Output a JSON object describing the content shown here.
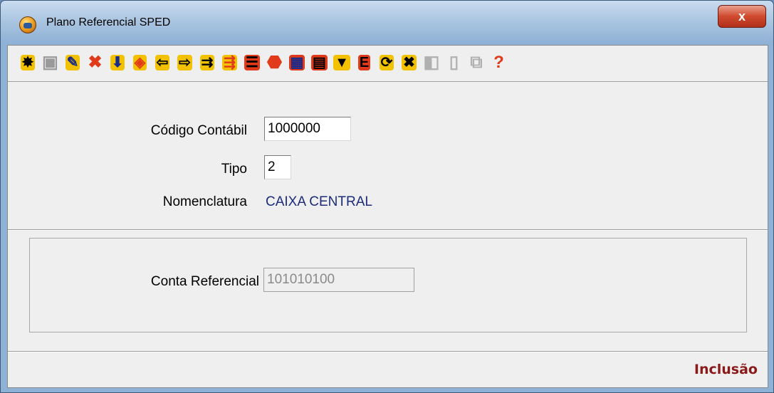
{
  "window": {
    "title": "Plano Referencial SPED",
    "close_label": "x"
  },
  "toolbar": {
    "buttons": [
      {
        "name": "gear-icon",
        "glyph": "✸",
        "color": "#000000",
        "bg": "#f2c200"
      },
      {
        "name": "save-icon",
        "glyph": "▣",
        "color": "#9a9a9a",
        "bg": ""
      },
      {
        "name": "edit-pencil-icon",
        "glyph": "✎",
        "color": "#1a2a8a",
        "bg": "#f2c200"
      },
      {
        "name": "delete-x-icon",
        "glyph": "✖",
        "color": "#e03a1a",
        "bg": ""
      },
      {
        "name": "download-arrow-icon",
        "glyph": "⬇",
        "color": "#1a2a8a",
        "bg": "#f2c200"
      },
      {
        "name": "search-icon",
        "glyph": "◈",
        "color": "#e03a1a",
        "bg": "#f2c200"
      },
      {
        "name": "arrow-left-icon",
        "glyph": "⇦",
        "color": "#000000",
        "bg": "#f2c200"
      },
      {
        "name": "arrow-right-icon",
        "glyph": "⇨",
        "color": "#000000",
        "bg": "#f2c200"
      },
      {
        "name": "export-xy-icon",
        "glyph": "⇉",
        "color": "#000000",
        "bg": "#f2c200"
      },
      {
        "name": "import-xy-icon",
        "glyph": "⇶",
        "color": "#e03a1a",
        "bg": "#f2c200"
      },
      {
        "name": "equal-bars-icon",
        "glyph": "☰",
        "color": "#000000",
        "bg": "#e03a1a"
      },
      {
        "name": "stop-icon",
        "glyph": "⬣",
        "color": "#e03a1a",
        "bg": ""
      },
      {
        "name": "calculator-icon",
        "glyph": "▦",
        "color": "#1a2a8a",
        "bg": "#e03a1a"
      },
      {
        "name": "report-icon",
        "glyph": "▤",
        "color": "#000000",
        "bg": "#e03a1a"
      },
      {
        "name": "comment-icon",
        "glyph": "▼",
        "color": "#000000",
        "bg": "#f2c200"
      },
      {
        "name": "list-e-icon",
        "glyph": "E",
        "color": "#000000",
        "bg": "#e03a1a"
      },
      {
        "name": "refresh-icon",
        "glyph": "⟳",
        "color": "#000000",
        "bg": "#f2c200"
      },
      {
        "name": "folder-icon",
        "glyph": "✖",
        "color": "#000000",
        "bg": "#f2c200"
      },
      {
        "name": "document-grey-icon",
        "glyph": "◧",
        "color": "#b0b0b0",
        "bg": ""
      },
      {
        "name": "page-grey-icon",
        "glyph": "▯",
        "color": "#b0b0b0",
        "bg": ""
      },
      {
        "name": "copy-grey-icon",
        "glyph": "⧉",
        "color": "#b0b0b0",
        "bg": ""
      },
      {
        "name": "help-icon",
        "glyph": "?",
        "color": "#e03a1a",
        "bg": ""
      }
    ]
  },
  "form": {
    "codigo_label": "Código Contábil",
    "codigo_value": "1000000",
    "tipo_label": "Tipo",
    "tipo_value": "2",
    "nomenclatura_label": "Nomenclatura",
    "nomenclatura_value": "CAIXA CENTRAL",
    "conta_label": "Conta Referencial",
    "conta_value": "101010100"
  },
  "status": {
    "mode": "Inclusão"
  }
}
